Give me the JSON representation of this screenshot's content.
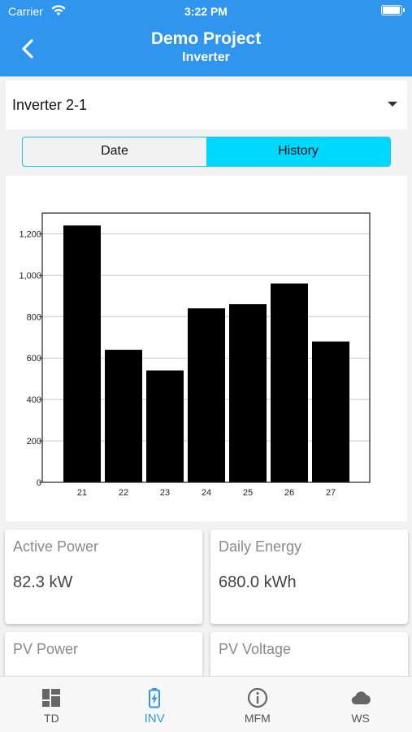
{
  "status_bar": {
    "carrier": "Carrier",
    "time": "3:22 PM",
    "battery_level": 1.0
  },
  "header": {
    "title": "Demo Project",
    "subtitle": "Inverter"
  },
  "selector": {
    "value": "Inverter 2-1"
  },
  "segments": {
    "date": "Date",
    "history": "History",
    "active": "History"
  },
  "chart_data": {
    "type": "bar",
    "categories": [
      "21",
      "22",
      "23",
      "24",
      "25",
      "26",
      "27"
    ],
    "values": [
      1240,
      640,
      540,
      840,
      860,
      960,
      680
    ],
    "ylim": [
      0,
      1300
    ],
    "yticks": [
      0,
      200,
      400,
      600,
      800,
      1000,
      1200
    ],
    "ytick_labels": [
      "0",
      "200",
      "400",
      "600",
      "800",
      "1,000",
      "1,200"
    ],
    "grid": true,
    "bar_color": "#000000"
  },
  "cards": [
    {
      "label": "Active Power",
      "value": "82.3 kW"
    },
    {
      "label": "Daily Energy",
      "value": "680.0 kWh"
    },
    {
      "label": "PV Power",
      "value": ""
    },
    {
      "label": "PV Voltage",
      "value": ""
    }
  ],
  "tabs": [
    {
      "label": "TD",
      "icon": "dashboard-icon"
    },
    {
      "label": "INV",
      "icon": "battery-charging-icon"
    },
    {
      "label": "MFM",
      "icon": "info-icon"
    },
    {
      "label": "WS",
      "icon": "cloud-icon"
    }
  ],
  "active_tab": "INV",
  "colors": {
    "accent": "#2f95ee",
    "segment_active": "#00d7ff",
    "segment_border": "#19c3ea"
  }
}
